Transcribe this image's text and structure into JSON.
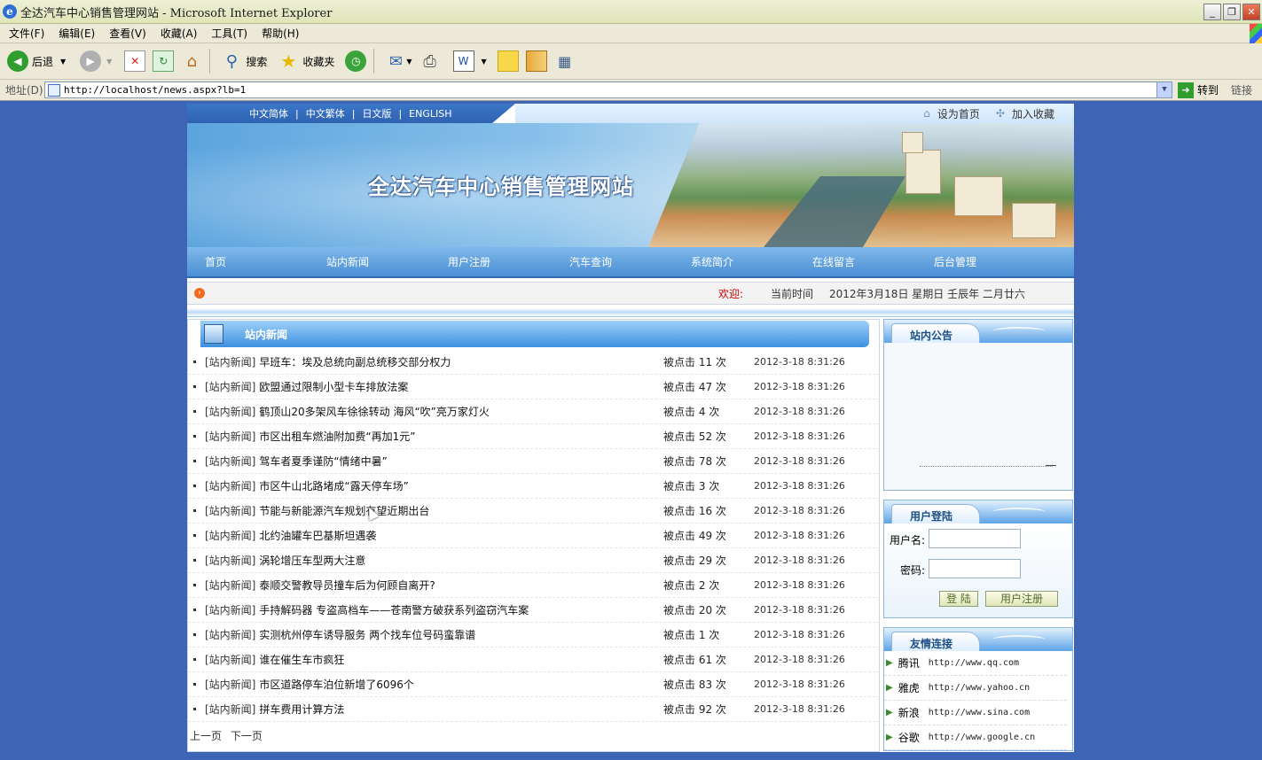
{
  "window": {
    "title": "全达汽车中心销售管理网站 - Microsoft Internet Explorer",
    "controls": [
      "_",
      "❐",
      "✕"
    ]
  },
  "menu": [
    "文件(F)",
    "编辑(E)",
    "查看(V)",
    "收藏(A)",
    "工具(T)",
    "帮助(H)"
  ],
  "toolbar": {
    "back": "后退",
    "search": "搜索",
    "favorites": "收藏夹"
  },
  "address": {
    "label": "地址(D)",
    "url": "http://localhost/news.aspx?lb=1",
    "go": "转到",
    "links": "链接"
  },
  "site": {
    "languages": [
      "中文简体",
      "中文繁体",
      "日文版",
      "ENGLISH"
    ],
    "set_home": "设为首页",
    "add_fav": "加入收藏",
    "title": "全达汽车中心销售管理网站",
    "nav": [
      "首页",
      "站内新闻",
      "用户注册",
      "汽车查询",
      "系统简介",
      "在线留言",
      "后台管理"
    ],
    "welcome": "欢迎:",
    "time_label": "当前时间",
    "time_value": "2012年3月18日 星期日 壬辰年 二月廿六",
    "news_header": "站内新闻",
    "news": [
      {
        "cat": "[站内新闻]",
        "title": "早班车：埃及总统向副总统移交部分权力",
        "clicks": "被点击 11 次",
        "date": "2012-3-18 8:31:26"
      },
      {
        "cat": "[站内新闻]",
        "title": "欧盟通过限制小型卡车排放法案",
        "clicks": "被点击 47 次",
        "date": "2012-3-18 8:31:26"
      },
      {
        "cat": "[站内新闻]",
        "title": "鹤顶山20多架风车徐徐转动 海风“吹”亮万家灯火",
        "clicks": "被点击 4 次",
        "date": "2012-3-18 8:31:26"
      },
      {
        "cat": "[站内新闻]",
        "title": "市区出租车燃油附加费“再加1元”",
        "clicks": "被点击 52 次",
        "date": "2012-3-18 8:31:26"
      },
      {
        "cat": "[站内新闻]",
        "title": "驾车者夏季谨防“情绪中暑”",
        "clicks": "被点击 78 次",
        "date": "2012-3-18 8:31:26"
      },
      {
        "cat": "[站内新闻]",
        "title": "市区牛山北路堵成“露天停车场”",
        "clicks": "被点击 3 次",
        "date": "2012-3-18 8:31:26"
      },
      {
        "cat": "[站内新闻]",
        "title": "节能与新能源汽车规划有望近期出台",
        "clicks": "被点击 16 次",
        "date": "2012-3-18 8:31:26"
      },
      {
        "cat": "[站内新闻]",
        "title": "北约油罐车巴基斯坦遇袭",
        "clicks": "被点击 49 次",
        "date": "2012-3-18 8:31:26"
      },
      {
        "cat": "[站内新闻]",
        "title": "涡轮增压车型两大注意",
        "clicks": "被点击 29 次",
        "date": "2012-3-18 8:31:26"
      },
      {
        "cat": "[站内新闻]",
        "title": "泰顺交警教导员撞车后为何顾自离开?",
        "clicks": "被点击 2 次",
        "date": "2012-3-18 8:31:26"
      },
      {
        "cat": "[站内新闻]",
        "title": "手持解码器 专盗高档车——苍南警方破获系列盗窃汽车案",
        "clicks": "被点击 20 次",
        "date": "2012-3-18 8:31:26"
      },
      {
        "cat": "[站内新闻]",
        "title": "实测杭州停车诱导服务 两个找车位号码蛮靠谱",
        "clicks": "被点击 1 次",
        "date": "2012-3-18 8:31:26"
      },
      {
        "cat": "[站内新闻]",
        "title": "谁在催生车市疯狂",
        "clicks": "被点击 61 次",
        "date": "2012-3-18 8:31:26"
      },
      {
        "cat": "[站内新闻]",
        "title": "市区道路停车泊位新增了6096个",
        "clicks": "被点击 83 次",
        "date": "2012-3-18 8:31:26"
      },
      {
        "cat": "[站内新闻]",
        "title": "拼车费用计算方法",
        "clicks": "被点击 92 次",
        "date": "2012-3-18 8:31:26"
      }
    ],
    "pager": {
      "prev": "上一页",
      "next": "下一页"
    },
    "notice_title": "站内公告",
    "login_title": "用户登陆",
    "username_label": "用户名:",
    "password_label": "密码:",
    "login_btn": "登 陆",
    "register_btn": "用户注册",
    "links_title": "友情连接",
    "friend_links": [
      {
        "name": "腾讯",
        "url": "http://www.qq.com"
      },
      {
        "name": "雅虎",
        "url": "http://www.yahoo.cn"
      },
      {
        "name": "新浪",
        "url": "http://www.sina.com"
      },
      {
        "name": "谷歌",
        "url": "http://www.google.cn"
      }
    ]
  }
}
